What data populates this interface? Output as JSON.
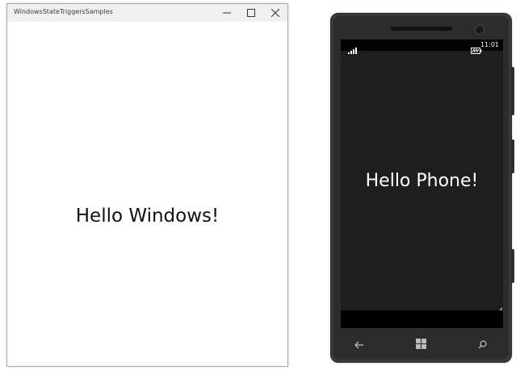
{
  "desktop_window": {
    "title": "WindowsStateTriggersSamples",
    "controls": {
      "minimize_icon": "minimize-icon",
      "maximize_icon": "maximize-icon",
      "close_icon": "close-icon"
    },
    "content_text": "Hello Windows!"
  },
  "phone_emulator": {
    "status_bar": {
      "signal_icon": "signal-strength-icon",
      "battery_icon": "battery-icon",
      "time": "11:01"
    },
    "content_text": "Hello Phone!",
    "nav_buttons": {
      "back_icon": "back-arrow-icon",
      "start_icon": "windows-start-icon",
      "search_icon": "search-icon"
    }
  },
  "colors": {
    "window_titlebar": "#f0f0f0",
    "window_background": "#ffffff",
    "phone_body": "#3a3a3a",
    "phone_screen": "#1e1e1e",
    "phone_text": "#ffffff",
    "accent_marker": "#e8743b"
  }
}
